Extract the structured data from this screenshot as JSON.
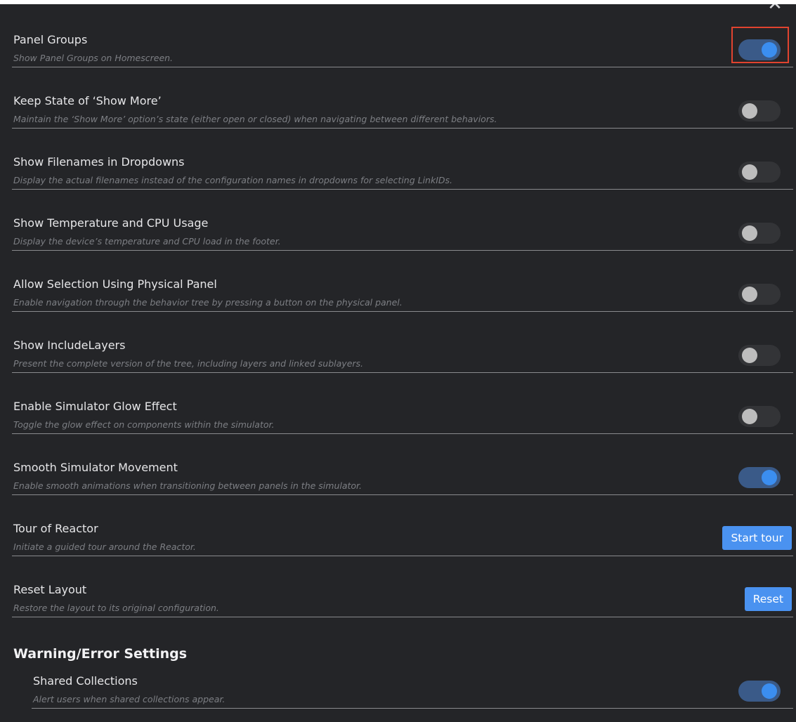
{
  "close_label": "✕",
  "settings": [
    {
      "title": "Panel Groups",
      "description": "Show Panel Groups on Homescreen.",
      "control": "toggle",
      "on": true
    },
    {
      "title": "Keep State of ‘Show More’",
      "description": "Maintain the ‘Show More’ option’s state (either open or closed) when navigating between different behaviors.",
      "control": "toggle",
      "on": false
    },
    {
      "title": "Show Filenames in Dropdowns",
      "description": "Display the actual filenames instead of the configuration names in dropdowns for selecting LinkIDs.",
      "control": "toggle",
      "on": false
    },
    {
      "title": "Show Temperature and CPU Usage",
      "description": "Display the device’s temperature and CPU load in the footer.",
      "control": "toggle",
      "on": false
    },
    {
      "title": "Allow Selection Using Physical Panel",
      "description": "Enable navigation through the behavior tree by pressing a button on the physical panel.",
      "control": "toggle",
      "on": false
    },
    {
      "title": "Show IncludeLayers",
      "description": "Present the complete version of the tree, including layers and linked sublayers.",
      "control": "toggle",
      "on": false
    },
    {
      "title": "Enable Simulator Glow Effect",
      "description": "Toggle the glow effect on components within the simulator.",
      "control": "toggle",
      "on": false
    },
    {
      "title": "Smooth Simulator Movement",
      "description": "Enable smooth animations when transitioning between panels in the simulator.",
      "control": "toggle",
      "on": true
    },
    {
      "title": "Tour of Reactor",
      "description": "Initiate a guided tour around the Reactor.",
      "control": "button",
      "button_label": "Start tour"
    },
    {
      "title": "Reset Layout",
      "description": "Restore the layout to its original configuration.",
      "control": "button",
      "button_label": "Reset"
    }
  ],
  "warning_section": {
    "heading": "Warning/Error Settings",
    "items": [
      {
        "title": "Shared Collections",
        "description": "Alert users when shared collections appear.",
        "control": "toggle",
        "on": true
      }
    ]
  },
  "colors": {
    "panel_bg": "#242528",
    "toggle_on_knob": "#3b8ef0",
    "button_bg": "#4a92f0",
    "highlight_border": "#e1432f"
  }
}
